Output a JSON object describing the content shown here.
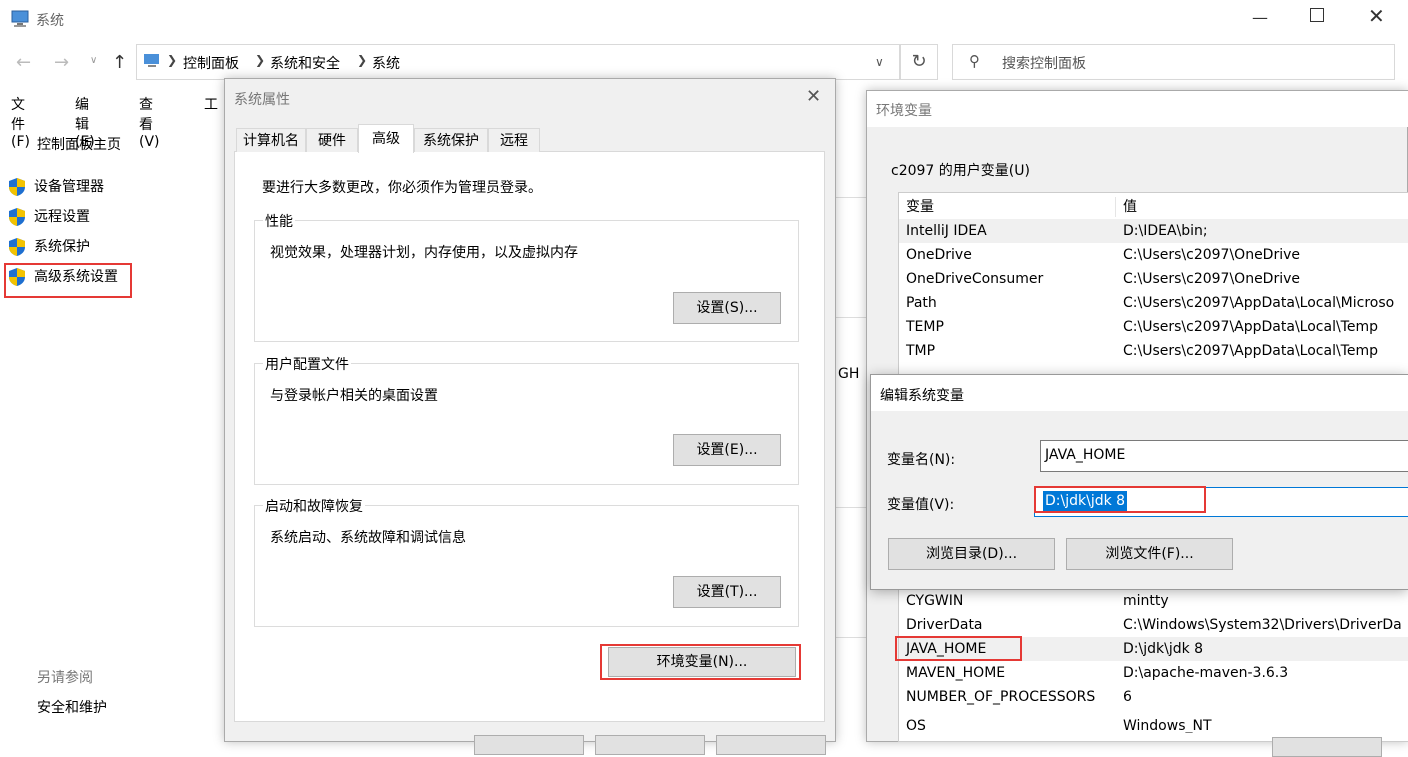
{
  "main_window": {
    "title": "系统",
    "breadcrumb": [
      "控制面板",
      "系统和安全",
      "系统"
    ],
    "search_placeholder": "搜索控制面板",
    "menu": [
      "文件(F)",
      "编辑(E)",
      "查看(V)",
      "工"
    ],
    "sidebar": {
      "home": "控制面板主页",
      "items": [
        "设备管理器",
        "远程设置",
        "系统保护",
        "高级系统设置"
      ],
      "see_also_header": "另请参阅",
      "see_also_items": [
        "安全和维护"
      ]
    },
    "partial_text": "GH"
  },
  "sys_props": {
    "title": "系统属性",
    "tabs": [
      "计算机名",
      "硬件",
      "高级",
      "系统保护",
      "远程"
    ],
    "admin_notice": "要进行大多数更改，你必须作为管理员登录。",
    "performance": {
      "label": "性能",
      "desc": "视觉效果，处理器计划，内存使用，以及虚拟内存",
      "button": "设置(S)..."
    },
    "user_profiles": {
      "label": "用户配置文件",
      "desc": "与登录帐户相关的桌面设置",
      "button": "设置(E)..."
    },
    "startup": {
      "label": "启动和故障恢复",
      "desc": "系统启动、系统故障和调试信息",
      "button": "设置(T)..."
    },
    "env_button": "环境变量(N)..."
  },
  "env_vars": {
    "title": "环境变量",
    "user_section": "c2097 的用户变量(U)",
    "columns": [
      "变量",
      "值"
    ],
    "user_rows": [
      {
        "name": "IntelliJ IDEA",
        "value": "D:\\IDEA\\bin;"
      },
      {
        "name": "OneDrive",
        "value": "C:\\Users\\c2097\\OneDrive"
      },
      {
        "name": "OneDriveConsumer",
        "value": "C:\\Users\\c2097\\OneDrive"
      },
      {
        "name": "Path",
        "value": "C:\\Users\\c2097\\AppData\\Local\\Microso"
      },
      {
        "name": "TEMP",
        "value": "C:\\Users\\c2097\\AppData\\Local\\Temp"
      },
      {
        "name": "TMP",
        "value": "C:\\Users\\c2097\\AppData\\Local\\Temp"
      }
    ],
    "system_rows": [
      {
        "name": "CYGWIN",
        "value": "mintty"
      },
      {
        "name": "DriverData",
        "value": "C:\\Windows\\System32\\Drivers\\DriverDa"
      },
      {
        "name": "JAVA_HOME",
        "value": "D:\\jdk\\jdk 8"
      },
      {
        "name": "MAVEN_HOME",
        "value": "D:\\apache-maven-3.6.3"
      },
      {
        "name": "NUMBER_OF_PROCESSORS",
        "value": "6"
      },
      {
        "name": "OS",
        "value": "Windows_NT"
      }
    ]
  },
  "edit_dialog": {
    "title": "编辑系统变量",
    "name_label": "变量名(N):",
    "name_value": "JAVA_HOME",
    "value_label": "变量值(V):",
    "value_value": "D:\\jdk\\jdk 8",
    "browse_dir": "浏览目录(D)...",
    "browse_file": "浏览文件(F)..."
  },
  "colors": {
    "highlight_red": "#e53935",
    "selection_blue": "#0078d7",
    "dialog_bg": "#f0f0f0"
  }
}
